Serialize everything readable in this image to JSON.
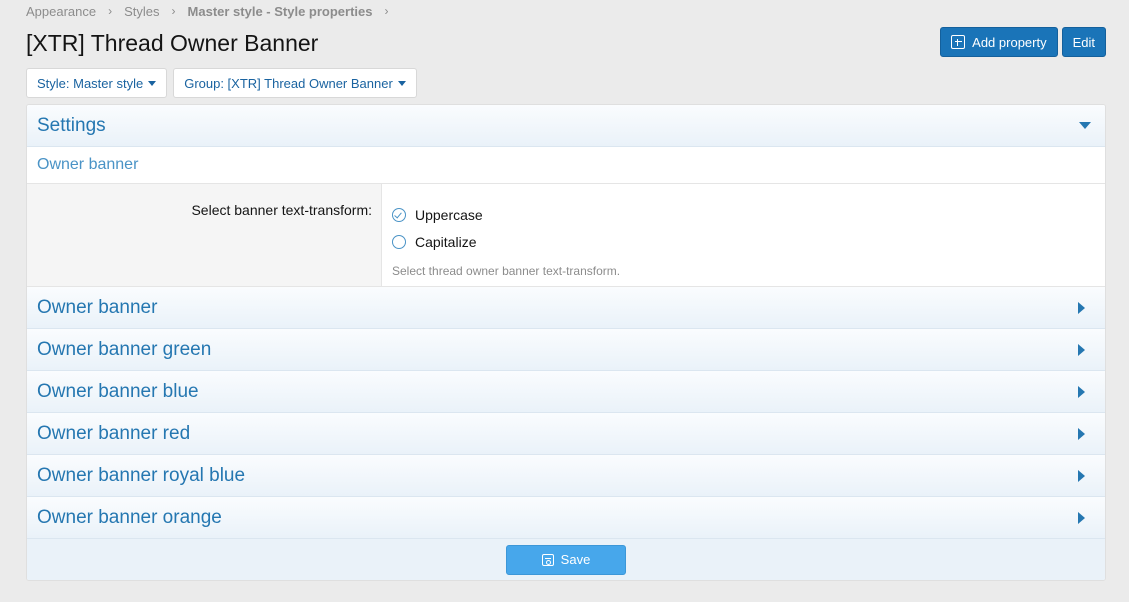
{
  "breadcrumb": {
    "items": [
      "Appearance",
      "Styles",
      "Master style - Style properties"
    ],
    "separator": "›"
  },
  "page": {
    "title": "[XTR] Thread Owner Banner"
  },
  "actions": {
    "add_property": "Add property",
    "edit": "Edit"
  },
  "filters": {
    "style": "Style: Master style",
    "group": "Group: [XTR] Thread Owner Banner"
  },
  "settings": {
    "header": "Settings",
    "subheader": "Owner banner",
    "field_label": "Select banner text-transform:",
    "options": [
      {
        "label": "Uppercase",
        "checked": true
      },
      {
        "label": "Capitalize",
        "checked": false
      }
    ],
    "hint": "Select thread owner banner text-transform."
  },
  "sections": [
    "Owner banner",
    "Owner banner green",
    "Owner banner blue",
    "Owner banner red",
    "Owner banner royal blue",
    "Owner banner orange"
  ],
  "footer": {
    "save": "Save"
  },
  "colors": {
    "accent": "#2577b1",
    "primary_button": "#1a74b8",
    "save_button": "#47a7eb"
  }
}
